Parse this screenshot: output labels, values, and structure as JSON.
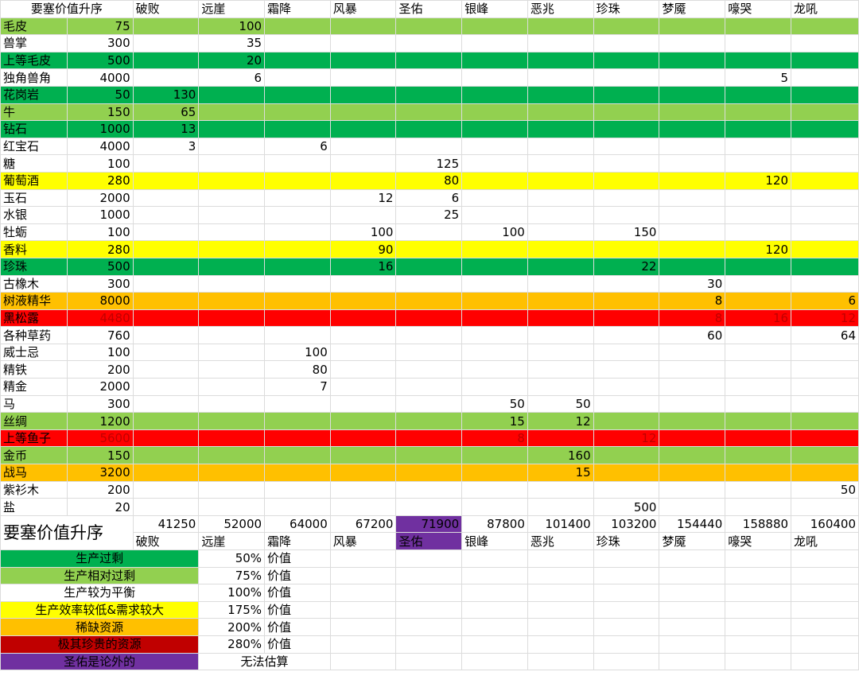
{
  "sheet": {
    "header": {
      "title": "要塞价值升序",
      "forts": [
        "破败",
        "远崖",
        "霜降",
        "风暴",
        "圣佑",
        "银峰",
        "恶兆",
        "珍珠",
        "梦魇",
        "嚎哭",
        "龙吼"
      ]
    },
    "rows": [
      {
        "name": "毛皮",
        "value": "75",
        "cells": [
          "",
          "100",
          "",
          "",
          "",
          "",
          "",
          "",
          "",
          "",
          ""
        ],
        "color": "lgreen"
      },
      {
        "name": "兽掌",
        "value": "300",
        "cells": [
          "",
          "35",
          "",
          "",
          "",
          "",
          "",
          "",
          "",
          "",
          ""
        ],
        "color": "white"
      },
      {
        "name": "上等毛皮",
        "value": "500",
        "cells": [
          "",
          "20",
          "",
          "",
          "",
          "",
          "",
          "",
          "",
          "",
          ""
        ],
        "color": "green"
      },
      {
        "name": "独角兽角",
        "value": "4000",
        "cells": [
          "",
          "6",
          "",
          "",
          "",
          "",
          "",
          "",
          "",
          "5",
          ""
        ],
        "color": "white"
      },
      {
        "name": "花岗岩",
        "value": "50",
        "cells": [
          "130",
          "",
          "",
          "",
          "",
          "",
          "",
          "",
          "",
          "",
          ""
        ],
        "color": "green"
      },
      {
        "name": "牛",
        "value": "150",
        "cells": [
          "65",
          "",
          "",
          "",
          "",
          "",
          "",
          "",
          "",
          "",
          ""
        ],
        "color": "lgreen"
      },
      {
        "name": "钻石",
        "value": "1000",
        "cells": [
          "13",
          "",
          "",
          "",
          "",
          "",
          "",
          "",
          "",
          "",
          ""
        ],
        "color": "green"
      },
      {
        "name": "红宝石",
        "value": "4000",
        "cells": [
          "3",
          "",
          "6",
          "",
          "",
          "",
          "",
          "",
          "",
          "",
          ""
        ],
        "color": "white"
      },
      {
        "name": "糖",
        "value": "100",
        "cells": [
          "",
          "",
          "",
          "",
          "125",
          "",
          "",
          "",
          "",
          "",
          ""
        ],
        "color": "white"
      },
      {
        "name": "葡萄酒",
        "value": "280",
        "cells": [
          "",
          "",
          "",
          "",
          "80",
          "",
          "",
          "",
          "",
          "120",
          ""
        ],
        "color": "yellow"
      },
      {
        "name": "玉石",
        "value": "2000",
        "cells": [
          "",
          "",
          "",
          "12",
          "6",
          "",
          "",
          "",
          "",
          "",
          ""
        ],
        "color": "white"
      },
      {
        "name": "水银",
        "value": "1000",
        "cells": [
          "",
          "",
          "",
          "",
          "25",
          "",
          "",
          "",
          "",
          "",
          ""
        ],
        "color": "white"
      },
      {
        "name": "牡蛎",
        "value": "100",
        "cells": [
          "",
          "",
          "",
          "100",
          "",
          "100",
          "",
          "150",
          "",
          "",
          ""
        ],
        "color": "white"
      },
      {
        "name": "香料",
        "value": "280",
        "cells": [
          "",
          "",
          "",
          "90",
          "",
          "",
          "",
          "",
          "",
          "120",
          ""
        ],
        "color": "yellow"
      },
      {
        "name": "珍珠",
        "value": "500",
        "cells": [
          "",
          "",
          "",
          "16",
          "",
          "",
          "",
          "22",
          "",
          "",
          ""
        ],
        "color": "green"
      },
      {
        "name": "古橡木",
        "value": "300",
        "cells": [
          "",
          "",
          "",
          "",
          "",
          "",
          "",
          "",
          "30",
          "",
          ""
        ],
        "color": "white"
      },
      {
        "name": "树液精华",
        "value": "8000",
        "cells": [
          "",
          "",
          "",
          "",
          "",
          "",
          "",
          "",
          "8",
          "",
          "6"
        ],
        "color": "orange"
      },
      {
        "name": "黑松露",
        "value": "4480",
        "cells": [
          "",
          "",
          "",
          "",
          "",
          "",
          "",
          "",
          "8",
          "16",
          "12"
        ],
        "color": "red"
      },
      {
        "name": "各种草药",
        "value": "760",
        "cells": [
          "",
          "",
          "",
          "",
          "",
          "",
          "",
          "",
          "60",
          "",
          "64"
        ],
        "color": "white"
      },
      {
        "name": "威士忌",
        "value": "100",
        "cells": [
          "",
          "",
          "100",
          "",
          "",
          "",
          "",
          "",
          "",
          "",
          ""
        ],
        "color": "white"
      },
      {
        "name": "精铁",
        "value": "200",
        "cells": [
          "",
          "",
          "80",
          "",
          "",
          "",
          "",
          "",
          "",
          "",
          ""
        ],
        "color": "white"
      },
      {
        "name": "精金",
        "value": "2000",
        "cells": [
          "",
          "",
          "7",
          "",
          "",
          "",
          "",
          "",
          "",
          "",
          ""
        ],
        "color": "white"
      },
      {
        "name": "马",
        "value": "300",
        "cells": [
          "",
          "",
          "",
          "",
          "",
          "50",
          "50",
          "",
          "",
          "",
          ""
        ],
        "color": "white"
      },
      {
        "name": "丝绸",
        "value": "1200",
        "cells": [
          "",
          "",
          "",
          "",
          "",
          "15",
          "12",
          "",
          "",
          "",
          ""
        ],
        "color": "lgreen"
      },
      {
        "name": "上等鱼子",
        "value": "5600",
        "cells": [
          "",
          "",
          "",
          "",
          "",
          "8",
          "",
          "12",
          "",
          "",
          ""
        ],
        "color": "red"
      },
      {
        "name": "金币",
        "value": "150",
        "cells": [
          "",
          "",
          "",
          "",
          "",
          "",
          "160",
          "",
          "",
          "",
          ""
        ],
        "color": "lgreen"
      },
      {
        "name": "战马",
        "value": "3200",
        "cells": [
          "",
          "",
          "",
          "",
          "",
          "",
          "15",
          "",
          "",
          "",
          ""
        ],
        "color": "orange"
      },
      {
        "name": "紫衫木",
        "value": "200",
        "cells": [
          "",
          "",
          "",
          "",
          "",
          "",
          "",
          "",
          "",
          "",
          "50"
        ],
        "color": "white"
      },
      {
        "name": "盐",
        "value": "20",
        "cells": [
          "",
          "",
          "",
          "",
          "",
          "",
          "",
          "500",
          "",
          "",
          ""
        ],
        "color": "white"
      }
    ],
    "totals": [
      "41250",
      "52000",
      "64000",
      "67200",
      "71900",
      "87800",
      "101400",
      "103200",
      "154440",
      "158880",
      "160400"
    ],
    "bottom_title": "要塞价值升序",
    "legend": [
      {
        "label": "生产过剩",
        "pct": "50%",
        "note": "价值",
        "color": "#00b050"
      },
      {
        "label": "生产相对过剩",
        "pct": "75%",
        "note": "价值",
        "color": "#92d050"
      },
      {
        "label": "生产较为平衡",
        "pct": "100%",
        "note": "价值",
        "color": "#ffffff"
      },
      {
        "label": "生产效率较低&需求较大",
        "pct": "175%",
        "note": "价值",
        "color": "#ffff00"
      },
      {
        "label": "稀缺资源",
        "pct": "200%",
        "note": "价值",
        "color": "#ffc000"
      },
      {
        "label": "极其珍贵的资源",
        "pct": "280%",
        "note": "价值",
        "color": "#c00000"
      },
      {
        "label": "圣佑是论外的",
        "pct": "",
        "note": "无法估算",
        "color": "#7030a0"
      }
    ]
  }
}
